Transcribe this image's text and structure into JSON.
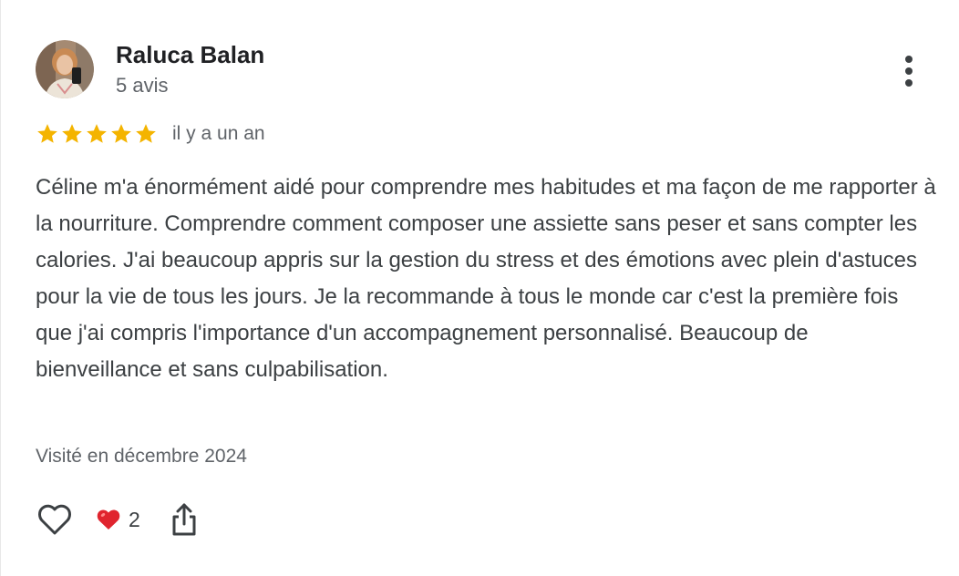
{
  "reviewer": {
    "name": "Raluca Balan",
    "review_count": "5 avis"
  },
  "rating": {
    "stars": 5,
    "max": 5,
    "star_color": "#f4b400",
    "date": "il y a un an"
  },
  "review": {
    "text": "Céline m'a énormément aidé pour comprendre mes habitudes et ma façon de me rapporter à la nourriture. Comprendre comment composer une assiette sans peser et sans compter les calories. J'ai beaucoup appris sur la gestion du stress et des émotions avec plein d'astuces pour la vie de tous les jours. Je la recommande à tous le monde car c'est la première fois que j'ai compris l'importance d'un accompagnement personnalisé. Beaucoup de bienveillance et sans culpabilisation.",
    "visit": "Visité en décembre 2024"
  },
  "actions": {
    "like_icon": "heart-outline-icon",
    "reaction_icon": "red-heart-icon",
    "reaction_count": "2",
    "share_icon": "share-icon",
    "more_icon": "more-vertical-icon"
  }
}
